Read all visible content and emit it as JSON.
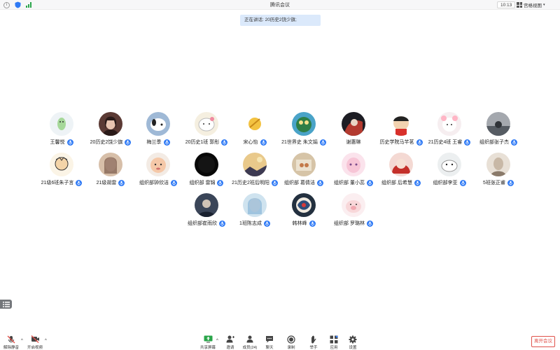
{
  "window": {
    "title": "腾讯会议",
    "time": "10:13",
    "view_mode": "宫格视图"
  },
  "banner": {
    "speaking": "正在讲话: 20历史2饶少旗;"
  },
  "participants": [
    {
      "name": "王馨悦",
      "mic": "mic-on-icon"
    },
    {
      "name": "20历史2饶少旗",
      "mic": "mic-on-icon"
    },
    {
      "name": "梅兰季",
      "mic": "mic-on-icon"
    },
    {
      "name": "20历史1班 郭彤",
      "mic": "mic-on-icon"
    },
    {
      "name": "宋心怡",
      "mic": "mic-on-icon"
    },
    {
      "name": "21世界史 朱文娟",
      "mic": "mic-on-icon"
    },
    {
      "name": "谢惠琳",
      "mic": ""
    },
    {
      "name": "历史学院马芊茗",
      "mic": "mic-on-icon"
    },
    {
      "name": "21历史4班 王睿",
      "mic": "mic-on-icon"
    },
    {
      "name": "组织部张子杰",
      "mic": "mic-on-icon"
    },
    {
      "name": "21级6班朱子言",
      "mic": "mic-on-icon"
    },
    {
      "name": "21级胡雷",
      "mic": "mic-on-icon"
    },
    {
      "name": "组织部钟欣洁",
      "mic": "mic-on-icon"
    },
    {
      "name": "组织部 雷锦",
      "mic": "mic-on-icon"
    },
    {
      "name": "21历史2班后明阳",
      "mic": "mic-on-icon"
    },
    {
      "name": "组织部 葛倩洁",
      "mic": "mic-on-icon"
    },
    {
      "name": "组织部 董小蕊",
      "mic": "mic-on-icon"
    },
    {
      "name": "组织部 后希慧",
      "mic": "mic-on-icon"
    },
    {
      "name": "组织部李亚",
      "mic": "mic-on-icon"
    },
    {
      "name": "5班张正睿",
      "mic": "mic-on-icon"
    },
    {
      "name": "组织部崔雨欣",
      "mic": "mic-on-icon"
    },
    {
      "name": "1班陈志成",
      "mic": "mic-on-icon"
    },
    {
      "name": "韩林峰",
      "mic": "mic-on-icon"
    },
    {
      "name": "组织部 罗璐林",
      "mic": "mic-on-icon"
    }
  ],
  "toolbar": {
    "unmute": "解除静音",
    "start_video": "开启视频",
    "share_screen": "共享屏幕",
    "invite": "邀请",
    "members": "成员(24)",
    "chat": "聊天",
    "record": "录制",
    "raise_hand": "举手",
    "apps": "应用",
    "settings": "设置",
    "leave": "离开会议"
  },
  "colors": {
    "accent": "#2f7af5",
    "leave": "#e0514a",
    "banner_bg": "#dbe9fb"
  }
}
